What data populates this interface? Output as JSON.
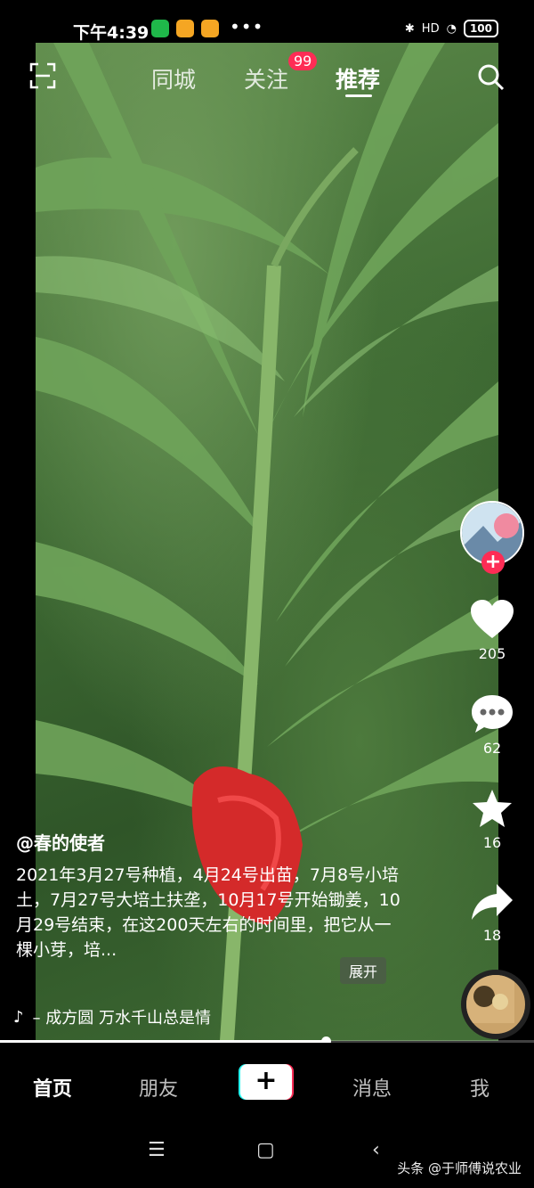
{
  "status": {
    "time": "下午4:39",
    "more": "•••",
    "network": "HD",
    "battery": "100"
  },
  "topnav": {
    "tabs": [
      "同城",
      "关注",
      "推荐"
    ],
    "active_tab": "推荐",
    "follow_badge": "99"
  },
  "actions": {
    "likes": "205",
    "comments": "62",
    "favorites": "16",
    "shares": "18"
  },
  "post": {
    "author": "@春的使者",
    "caption": "2021年3月27号种植，4月24号出苗，7月8号小培土，7月27号大培土扶垄，10月17号开始锄姜，10月29号结束，在这200天左右的时间里，把它从一棵小芽，培...",
    "expand": "展开",
    "music": "– 成方圆   万水千山总是情",
    "progress": 0.61
  },
  "bottomnav": {
    "items": [
      "首页",
      "朋友",
      "消息",
      "我"
    ],
    "plus": "+"
  },
  "watermark": "头条 @于师傅说农业",
  "colors": {
    "accent": "#fe2c55",
    "cyan": "#25f4ee"
  }
}
